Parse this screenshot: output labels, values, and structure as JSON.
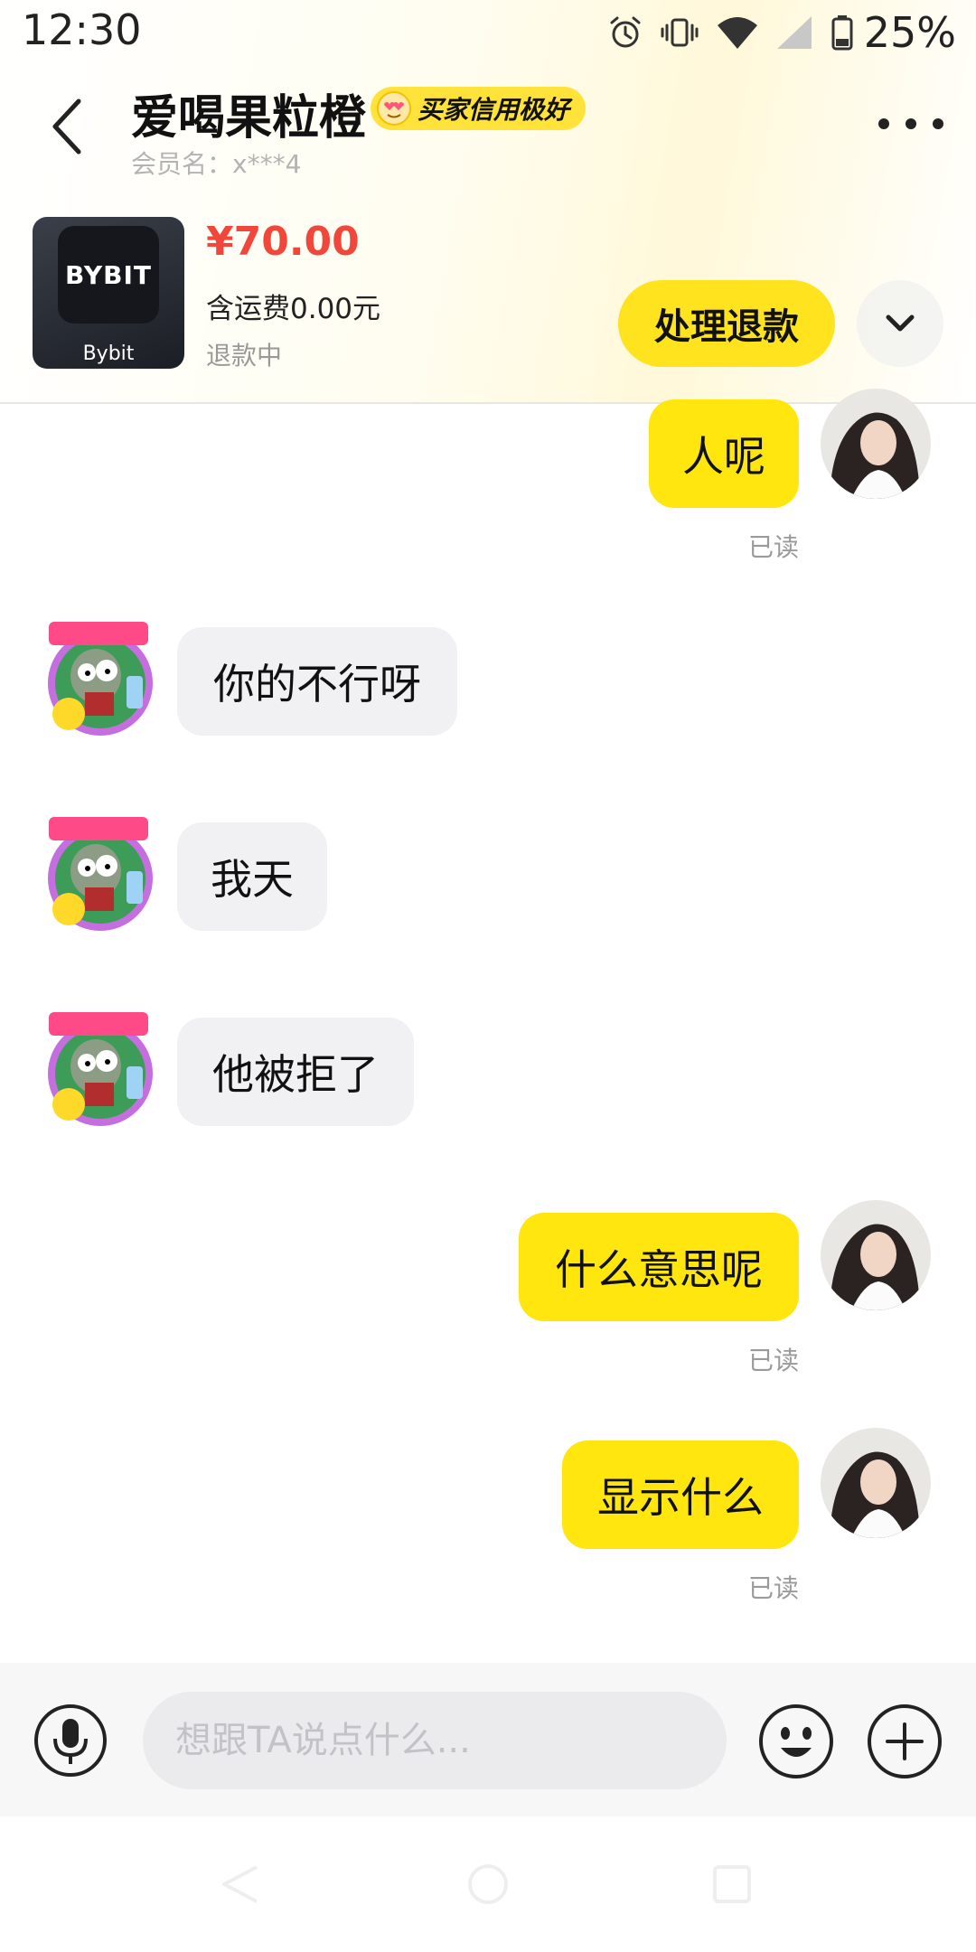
{
  "status_bar": {
    "time": "12:30",
    "battery": "25%"
  },
  "header": {
    "contact_name": "爱喝果粒橙",
    "credit_badge": "买家信用极好",
    "member_label": "会员名：x***4"
  },
  "product": {
    "thumb_logo": "BYBIT",
    "thumb_caption": "Bybit",
    "price": "¥70.00",
    "shipping": "含运费0.00元",
    "status": "退款中",
    "refund_button": "处理退款"
  },
  "messages": [
    {
      "side": "out",
      "text": "人呢",
      "receipt": "已读"
    },
    {
      "side": "in",
      "text": "你的不行呀"
    },
    {
      "side": "in",
      "text": "我天"
    },
    {
      "side": "in",
      "text": "他被拒了"
    },
    {
      "side": "out",
      "text": "什么意思呢",
      "receipt": "已读"
    },
    {
      "side": "out",
      "text": "显示什么",
      "receipt": "已读"
    }
  ],
  "input": {
    "placeholder": "想跟TA说点什么..."
  },
  "icons": {
    "back": "back-arrow-icon",
    "more": "more-dots-icon",
    "expand": "chevron-down-icon",
    "voice": "microphone-icon",
    "emoji": "smiley-icon",
    "plus": "plus-icon"
  },
  "colors": {
    "accent_yellow": "#ffe60f",
    "price_red": "#f0473a",
    "incoming_bubble": "#f1f1f3"
  }
}
